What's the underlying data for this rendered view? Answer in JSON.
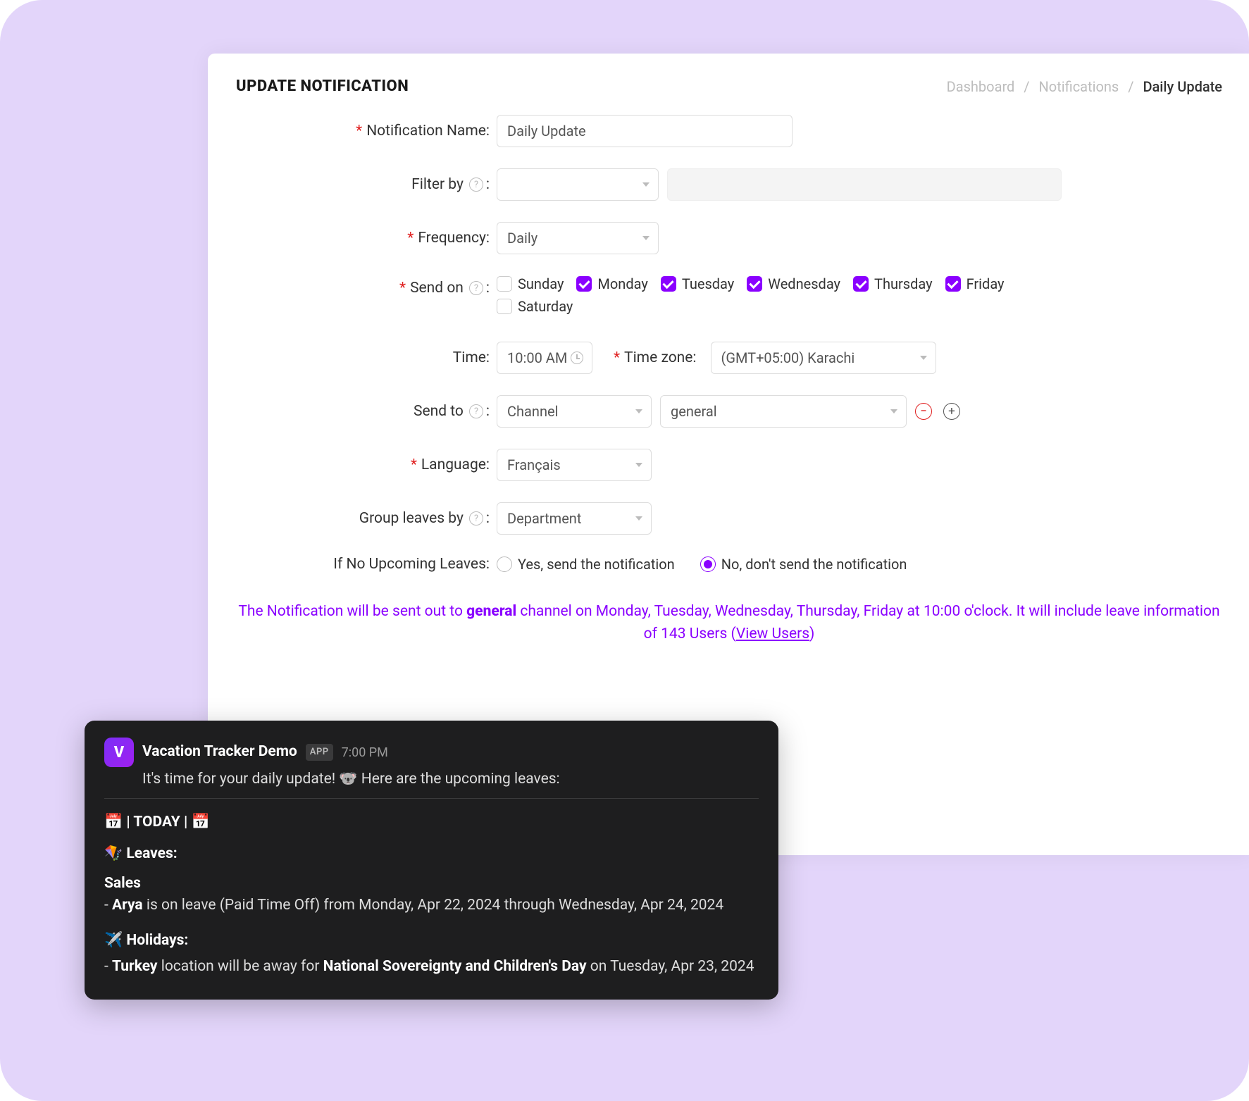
{
  "header": {
    "title": "UPDATE NOTIFICATION",
    "breadcrumbs": {
      "a": "Dashboard",
      "b": "Notifications",
      "c": "Daily Update"
    }
  },
  "form": {
    "name_label": "Notification Name:",
    "name_value": "Daily Update",
    "filter_label": "Filter by",
    "frequency_label": "Frequency:",
    "frequency_value": "Daily",
    "sendon_label": "Send on",
    "days": {
      "sun": {
        "label": "Sunday",
        "on": false
      },
      "mon": {
        "label": "Monday",
        "on": true
      },
      "tue": {
        "label": "Tuesday",
        "on": true
      },
      "wed": {
        "label": "Wednesday",
        "on": true
      },
      "thu": {
        "label": "Thursday",
        "on": true
      },
      "fri": {
        "label": "Friday",
        "on": true
      },
      "sat": {
        "label": "Saturday",
        "on": false
      }
    },
    "time_label": "Time:",
    "time_value": "10:00 AM",
    "tz_label": "Time zone:",
    "tz_value": "(GMT+05:00) Karachi",
    "sendto_label": "Send to",
    "sendto_type": "Channel",
    "sendto_target": "general",
    "language_label": "Language:",
    "language_value": "Français",
    "group_label": "Group leaves by",
    "group_value": "Department",
    "ifnone_label": "If No Upcoming Leaves:",
    "ifnone_yes": "Yes, send the notification",
    "ifnone_no": "No, don't send the notification"
  },
  "summary": {
    "pre": "The Notification will be sent out to ",
    "channel": "general",
    "mid": " channel on Monday, Tuesday, Wednesday, Thursday, Friday at 10:00 o'clock. It will include leave information of 143 Users (",
    "link": "View Users",
    "post": ")"
  },
  "slack": {
    "app_name": "Vacation Tracker Demo",
    "badge": "APP",
    "time": "7:00 PM",
    "intro": "It's time for your daily update! 🐨 Here are the upcoming leaves:",
    "today": "📅 |  TODAY  | 📅",
    "leaves_head": "🪁 Leaves:",
    "dept": "Sales",
    "leave_pre": "- ",
    "leave_name": "Arya",
    "leave_rest": " is on leave (Paid Time Off) from Monday, Apr 22, 2024 through Wednesday, Apr 24, 2024",
    "holidays_head": "✈️ Holidays:",
    "hol_pre": "- ",
    "hol_loc": "Turkey",
    "hol_mid": " location will be away for ",
    "hol_name": "National Sovereignty and Children's Day",
    "hol_rest": " on Tuesday, Apr 23, 2024"
  }
}
